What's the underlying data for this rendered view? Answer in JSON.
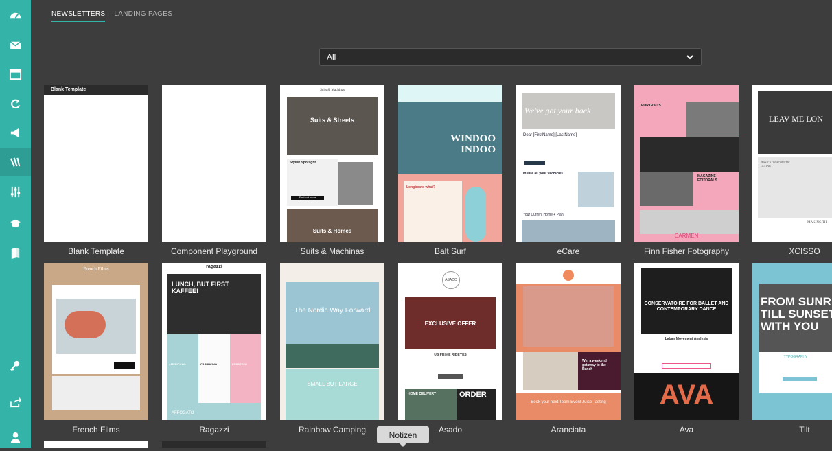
{
  "tabs": [
    {
      "label": "NEWSLETTERS"
    },
    {
      "label": "LANDING PAGES"
    }
  ],
  "filter": {
    "selected": "All"
  },
  "sidebar": {
    "items": [
      "dashboard-icon",
      "mail-icon",
      "window-icon",
      "refresh-icon",
      "megaphone-icon",
      "templates-icon",
      "sliders-icon",
      "graduation-cap-icon",
      "book-icon",
      "key-icon",
      "share-icon",
      "user-icon"
    ]
  },
  "templates": [
    {
      "name": "Blank Template",
      "preview_header": "Blank Template"
    },
    {
      "name": "Component Playground"
    },
    {
      "name": "Suits & Machinas",
      "preview_title": "Suits & Machinas",
      "preview_text": [
        "Suits & Streets",
        "Stylist Spotlight",
        "Find out more",
        "Suits & Homes"
      ]
    },
    {
      "name": "Balt Surf",
      "preview_text": [
        "WINDOO INDOO",
        "Longboard what?"
      ]
    },
    {
      "name": "eCare",
      "preview_text": [
        "We've got your back",
        "Dear [FirstName] [LastName]",
        "Insure all your vechicles",
        "Your Current Home + Plan"
      ]
    },
    {
      "name": "Finn Fisher Fotography",
      "preview_text": [
        "PORTRAITS",
        "MAGAZINE EDITORALS",
        "CARMEN"
      ]
    },
    {
      "name": "XCISSO",
      "preview_text": [
        "LEAV ME LON",
        "JESSICA ON ACOUSTIC GUITAR",
        "MAKING TH"
      ]
    },
    {
      "name": "French Films",
      "preview_title": "French Films"
    },
    {
      "name": "Ragazzi",
      "preview_title": "ragazzi",
      "preview_text": [
        "LUNCH, BUT FIRST KAFFEE!",
        "AMERICANO",
        "CAPPUCINO",
        "ESPRESSO",
        "AFFOGATO"
      ]
    },
    {
      "name": "Rainbow Camping",
      "preview_text": [
        "The Nordic Way Forward",
        "SMALL BUT LARGE"
      ]
    },
    {
      "name": "Asado",
      "preview_title": "ASADO",
      "preview_text": [
        "EXCLUSIVE OFFER",
        "US PRIME RIBEYES",
        "HOME DELIVERY",
        "ORDER"
      ]
    },
    {
      "name": "Aranciata",
      "preview_text": [
        "Win a weekend getaway to the Ranch",
        "Book your next Team Event Juice Tasting"
      ]
    },
    {
      "name": "Ava",
      "preview_text": [
        "CONSERVATOIRE FOR BALLET AND CONTEMPORARY DANCE",
        "Laban Movement Analysis",
        "AVA"
      ]
    },
    {
      "name": "Tilt",
      "preview_text": [
        "FROM SUNRIS TILL SUNSET WITH YOU",
        "TYPOGRAPHY"
      ]
    }
  ],
  "tooltip": {
    "label": "Notizen"
  },
  "colors": {
    "accent": "#34b3a8",
    "background": "#3d3d3d"
  }
}
